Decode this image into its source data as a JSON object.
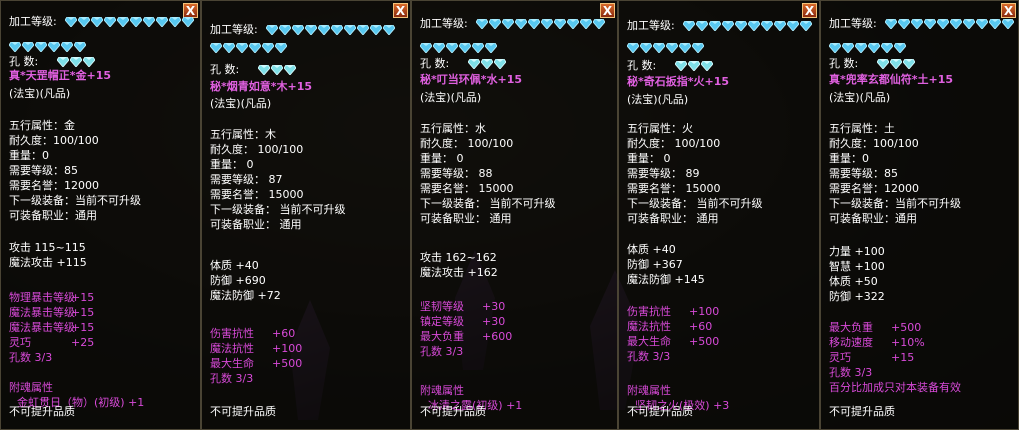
{
  "panels": [
    {
      "id": "p1",
      "close_label": "X",
      "level_label": "加工等级:",
      "gems_row1": 10,
      "gems_row2": 6,
      "holes_label": "孔    数:",
      "hole_gems": 3,
      "name": "真*天罡帽正*金+15",
      "type": "(法宝)(凡品)",
      "attrs": [
        "五行属性：金",
        "耐久度：100/100",
        "重量：0",
        "需要等级：85",
        "需要名誉：12000",
        "下一级装备：当前不可升级",
        "可装备职业：通用"
      ],
      "combat": [
        "攻击 115~115",
        "魔法攻击 +115"
      ],
      "bonus": [
        {
          "k": "物理暴击等级",
          "v": "+15"
        },
        {
          "k": "魔法暴击等级",
          "v": "+15"
        },
        {
          "k": "魔法暴击等级",
          "v": "+15"
        },
        {
          "k": "灵巧",
          "v": "+25"
        },
        {
          "k": "孔数 3/3",
          "v": ""
        }
      ],
      "soul_title": "附魂属性",
      "soul_value": "金虹贯日（物）(初级) +1",
      "footer": "不可提升品质"
    },
    {
      "id": "p2",
      "close_label": "X",
      "level_label": "加工等级:",
      "gems_row1": 10,
      "gems_row2": 6,
      "holes_label": "孔    数:",
      "hole_gems": 3,
      "name": "秘*烟青如意*木+15",
      "type": "(法宝)(凡品)",
      "attrs": [
        "五行属性：木",
        "耐久度： 100/100",
        "重量： 0",
        "需要等级： 87",
        "需要名誉： 15000",
        "下一级装备： 当前不可升级",
        "可装备职业： 通用"
      ],
      "combat": [
        "体质 +40",
        "防御 +690",
        "魔法防御 +72"
      ],
      "bonus": [
        {
          "k": "伤害抗性",
          "v": "+60"
        },
        {
          "k": "魔法抗性",
          "v": "+100"
        },
        {
          "k": "最大生命",
          "v": "+500"
        },
        {
          "k": "孔数 3/3",
          "v": ""
        }
      ],
      "footer": "不可提升品质"
    },
    {
      "id": "p3",
      "close_label": "X",
      "level_label": "加工等级:",
      "gems_row1": 10,
      "gems_row2": 6,
      "holes_label": "孔    数:",
      "hole_gems": 3,
      "name": "秘*叮当环佩*水+15",
      "type": "(法宝)(凡品)",
      "attrs": [
        "五行属性：水",
        "耐久度： 100/100",
        "重量： 0",
        "需要等级： 88",
        "需要名誉： 15000",
        "下一级装备： 当前不可升级",
        "可装备职业： 通用"
      ],
      "combat": [
        "攻击 162~162",
        "魔法攻击 +162"
      ],
      "bonus": [
        {
          "k": "坚韧等级",
          "v": "+30"
        },
        {
          "k": "镇定等级",
          "v": "+30"
        },
        {
          "k": "最大负重",
          "v": "+600"
        },
        {
          "k": "孔数 3/3",
          "v": ""
        }
      ],
      "soul_title": "附魂属性",
      "soul_value": "冰清之露(初级) +1",
      "footer": "不可提升品质"
    },
    {
      "id": "p4",
      "close_label": "X",
      "level_label": "加工等级:",
      "gems_row1": 10,
      "gems_row2": 6,
      "holes_label": "孔    数:",
      "hole_gems": 3,
      "name": "秘*奇石扳指*火+15",
      "type": "(法宝)(凡品)",
      "attrs": [
        "五行属性：火",
        "耐久度： 100/100",
        "重量： 0",
        "需要等级： 89",
        "需要名誉： 15000",
        "下一级装备： 当前不可升级",
        "可装备职业： 通用"
      ],
      "combat": [
        "体质 +40",
        "防御 +367",
        "魔法防御 +145"
      ],
      "bonus": [
        {
          "k": "伤害抗性",
          "v": "+100"
        },
        {
          "k": "魔法抗性",
          "v": "+60"
        },
        {
          "k": "最大生命",
          "v": "+500"
        },
        {
          "k": "孔数 3/3",
          "v": ""
        }
      ],
      "soul_title": "附魂属性",
      "soul_value": "坚韧之火(极效) +3",
      "footer": "不可提升品质"
    },
    {
      "id": "p5",
      "close_label": "X",
      "level_label": "加工等级:",
      "gems_row1": 10,
      "gems_row2": 6,
      "holes_label": "孔    数:",
      "hole_gems": 3,
      "name": "真*兜率玄都仙符*土+15",
      "type": "(法宝)(凡品)",
      "attrs": [
        "五行属性：土",
        "耐久度：100/100",
        "重量：0",
        "需要等级：85",
        "需要名誉：12000",
        "下一级装备：当前不可升级",
        "可装备职业：通用"
      ],
      "combat": [
        "力量 +100",
        "智慧 +100",
        "体质 +50",
        "防御 +322"
      ],
      "bonus": [
        {
          "k": "最大负重",
          "v": "+500"
        },
        {
          "k": "移动速度",
          "v": "+10%"
        },
        {
          "k": "灵巧",
          "v": "+15"
        },
        {
          "k": "孔数 3/3",
          "v": ""
        },
        {
          "k": "百分比加成只对本装备有效",
          "v": ""
        }
      ],
      "footer": "不可提升品质"
    }
  ],
  "colors": {
    "name": "#e060e0",
    "bonus": "#d84ad8",
    "text": "#ffffff",
    "gem": "#58c8f0"
  }
}
